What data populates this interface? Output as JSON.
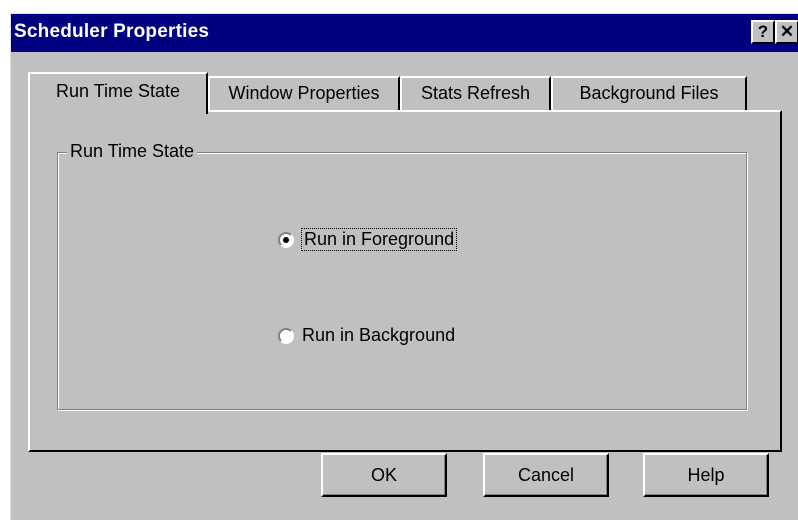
{
  "window": {
    "title": "Scheduler Properties",
    "help_button": "?",
    "close_button": "✕"
  },
  "tabs": [
    {
      "label": "Run Time State",
      "active": true
    },
    {
      "label": "Window Properties",
      "active": false
    },
    {
      "label": "Stats Refresh",
      "active": false
    },
    {
      "label": "Background Files",
      "active": false
    }
  ],
  "group": {
    "label": "Run Time State",
    "options": [
      {
        "label": "Run in Foreground",
        "selected": true
      },
      {
        "label": "Run in Background",
        "selected": false
      }
    ]
  },
  "buttons": {
    "ok": "OK",
    "cancel": "Cancel",
    "help": "Help"
  },
  "colors": {
    "titlebar": "#000080",
    "face": "#c0c0c0"
  }
}
